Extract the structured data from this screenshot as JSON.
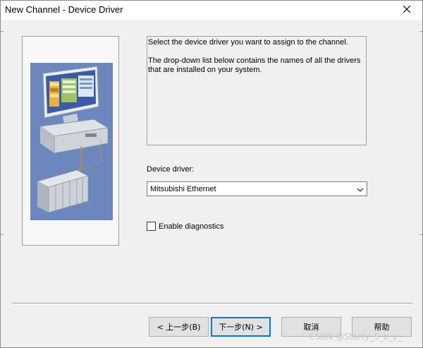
{
  "window": {
    "title": "New Channel - Device Driver"
  },
  "info": {
    "line1": "Select the device driver you want to assign to the channel.",
    "line2": "The drop-down list below contains the names of all the drivers that are installed on your system."
  },
  "device_driver": {
    "label": "Device driver:",
    "selected": "Mitsubishi Ethernet"
  },
  "diagnostics": {
    "label": "Enable diagnostics",
    "checked": false
  },
  "buttons": {
    "back": "< 上一步(B)",
    "next": "下一步(N) >",
    "cancel": "取消",
    "help": "帮助"
  },
  "watermark": "CSDN @Starry_S_k_y_",
  "icons": {
    "close": "close-icon",
    "dropdown": "chevron-down-icon",
    "illustration": "computer-plc-illustration"
  },
  "colors": {
    "illustration_bg": "#6b87bd",
    "default_button_border": "#0078d7"
  }
}
